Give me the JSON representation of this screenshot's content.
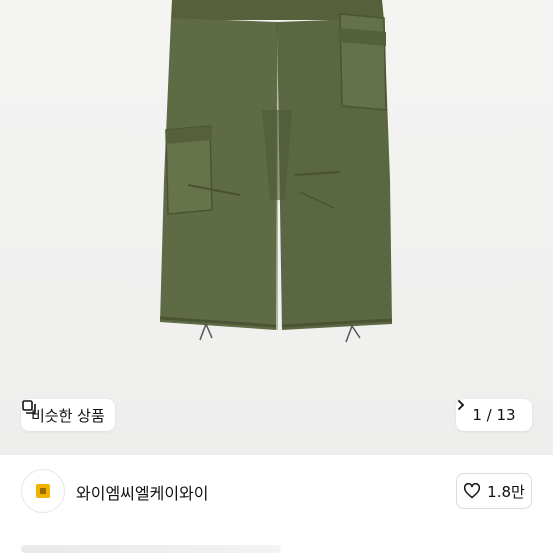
{
  "product": {
    "image_alt": "olive cargo pants",
    "similar_button": {
      "label": "비슷한 상품",
      "icon": "similar-items-icon"
    },
    "counter": {
      "text": "1 / 13",
      "icon": "chevron-right-icon"
    }
  },
  "seller": {
    "name": "와이엠씨엘케이와이",
    "avatar_icon": "store-logo-icon",
    "like": {
      "count": "1.8만",
      "icon": "heart-outline-icon"
    }
  },
  "colors": {
    "pants": "#5f6b45",
    "background": "#f2f2f1",
    "logo": "#f0b400"
  }
}
